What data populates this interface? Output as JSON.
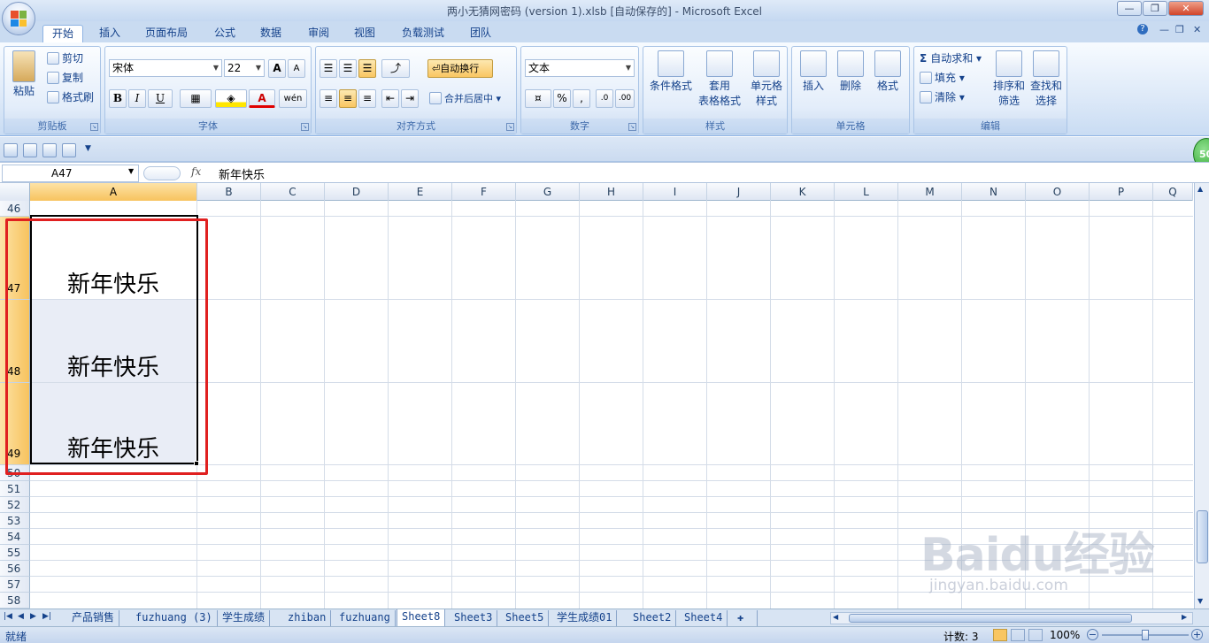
{
  "window": {
    "title": "两小无猜网密码 (version 1).xlsb [自动保存的] - Microsoft Excel",
    "min": "—",
    "restore": "❐",
    "close": "✕"
  },
  "tabs": [
    "开始",
    "插入",
    "页面布局",
    "公式",
    "数据",
    "审阅",
    "视图",
    "负载测试",
    "团队"
  ],
  "ribbon_controls": {
    "help": "?",
    "min": "—",
    "restore": "❐",
    "close": "✕"
  },
  "clipboard": {
    "paste": "粘贴",
    "cut": "剪切",
    "copy": "复制",
    "format_painter": "格式刷",
    "label": "剪贴板"
  },
  "font": {
    "name": "宋体",
    "size": "22",
    "bold": "B",
    "italic": "I",
    "underline": "U",
    "grow": "A",
    "shrink": "A",
    "color_letter": "A",
    "wen": "wén",
    "label": "字体"
  },
  "alignment": {
    "wrap": "自动换行",
    "merge": "合并后居中",
    "label": "对齐方式"
  },
  "number": {
    "format": "文本",
    "percent": "%",
    "comma": ",",
    "inc": ".0",
    "dec": ".00",
    "label": "数字"
  },
  "styles": {
    "conditional": "条件格式",
    "table_a": "套用",
    "table_b": "表格格式",
    "cell_a": "单元格",
    "cell_b": "样式",
    "label": "样式"
  },
  "cells": {
    "insert": "插入",
    "delete": "删除",
    "format": "格式",
    "label": "单元格"
  },
  "editing": {
    "autosum": "自动求和",
    "fill": "填充",
    "clear": "清除",
    "sort_a": "排序和",
    "sort_b": "筛选",
    "find_a": "查找和",
    "find_b": "选择",
    "label": "编辑"
  },
  "formula_bar": {
    "name_box": "A47",
    "fx": "fx",
    "content": "新年快乐"
  },
  "columns": [
    "A",
    "B",
    "C",
    "D",
    "E",
    "F",
    "G",
    "H",
    "I",
    "J",
    "K",
    "L",
    "M",
    "N",
    "O",
    "P",
    "Q"
  ],
  "rows": [
    "46",
    "47",
    "48",
    "49",
    "50",
    "51",
    "52",
    "53",
    "54",
    "55",
    "56",
    "57",
    "58"
  ],
  "cells_data": {
    "A47": "新年快乐",
    "A48": "新年快乐",
    "A49": "新年快乐"
  },
  "sheets": [
    "产品销售",
    "fuzhuang (3)",
    "学生成绩",
    "zhiban",
    "fuzhuang",
    "Sheet8",
    "Sheet3",
    "Sheet5",
    "学生成绩01",
    "Sheet2",
    "Sheet4"
  ],
  "status": {
    "ready": "就绪",
    "count": "计数: 3",
    "zoom": "100%"
  },
  "badge": "50",
  "watermark": {
    "logo": "Baidu经验",
    "url": "jingyan.baidu.com"
  },
  "colors": {
    "highlight_box": "#e02020",
    "selected_header": "#f7c35e"
  }
}
